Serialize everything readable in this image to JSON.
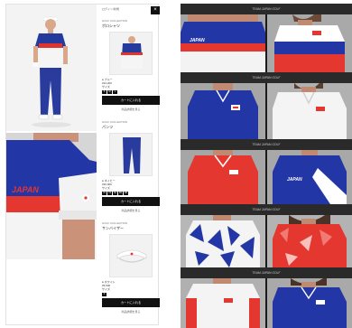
{
  "left_panel": {
    "favorite_label": "ログイン/新規",
    "close_icon": "close-icon",
    "items": [
      {
        "brand": "GOLF COLLECTION",
        "name": "ポロシャツ",
        "color_label": "● ブルー",
        "price": "¥24,200",
        "size_label": "サイズ",
        "sizes": [
          "S",
          "M",
          "L"
        ],
        "cart": "カートに入れる",
        "more": "商品詳細を見る"
      },
      {
        "brand": "GOLF COLLECTION",
        "name": "パンツ",
        "color_label": "● ネイビー",
        "price": "¥20,900",
        "size_label": "サイズ",
        "sizes": [
          "76",
          "79",
          "82",
          "85",
          "88"
        ],
        "cart": "カートに入れる",
        "more": "商品詳細を見る"
      },
      {
        "brand": "GOLF COLLECTION",
        "name": "サンバイザー",
        "color_label": "● ホワイト",
        "price": "¥5,500",
        "size_label": "サイズ",
        "sizes": [
          "F"
        ],
        "cart": "カートに入れる",
        "more": "商品詳細を見る"
      }
    ],
    "logo_text": "JAPAN"
  },
  "gallery": {
    "section_titles": [
      "TEAM JAPAN GOLF",
      "TEAM JAPAN GOLF",
      "TEAM JAPAN GOLF",
      "TEAM JAPAN GOLF",
      "TEAM JAPAN GOLF"
    ],
    "shirt_text": "JAPAN"
  }
}
